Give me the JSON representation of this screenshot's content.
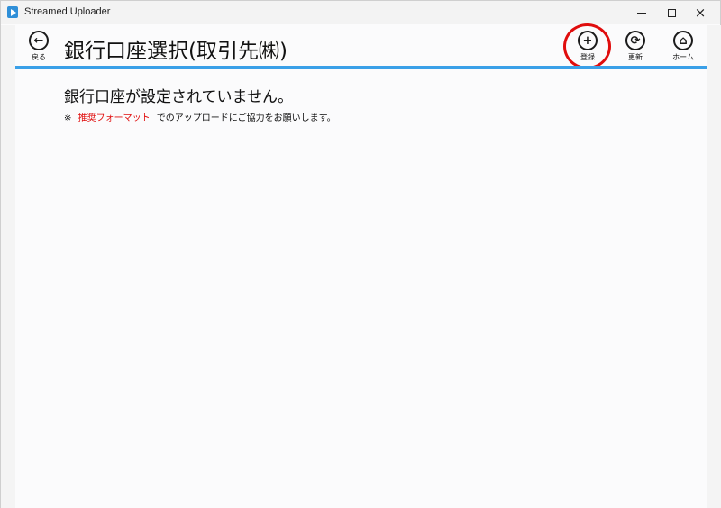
{
  "window": {
    "title": "Streamed Uploader",
    "icon": "app-play-icon",
    "controls": {
      "minimize": "minimize-icon",
      "maximize": "maximize-icon",
      "close": "close-icon",
      "close_glyph": "×"
    }
  },
  "header": {
    "back_label": "戻る",
    "back_glyph": "←",
    "title": "銀行口座選択(取引先㈱)",
    "accent_color": "#3aa0e8"
  },
  "toolbar": {
    "register": {
      "label": "登録",
      "glyph": "+",
      "icon": "plus-circle-icon",
      "highlighted": true
    },
    "refresh": {
      "label": "更新",
      "glyph": "⟳",
      "icon": "refresh-circle-icon"
    },
    "home": {
      "label": "ホーム",
      "glyph": "⌂",
      "icon": "home-circle-icon"
    }
  },
  "content": {
    "empty_message": "銀行口座が設定されていません。",
    "note_prefix": "※",
    "note_link": "推奨フォーマット",
    "note_suffix": "でのアップロードにご協力をお願いします。"
  },
  "colors": {
    "highlight_ring": "#e00d0d",
    "link": "#e00d0d"
  }
}
